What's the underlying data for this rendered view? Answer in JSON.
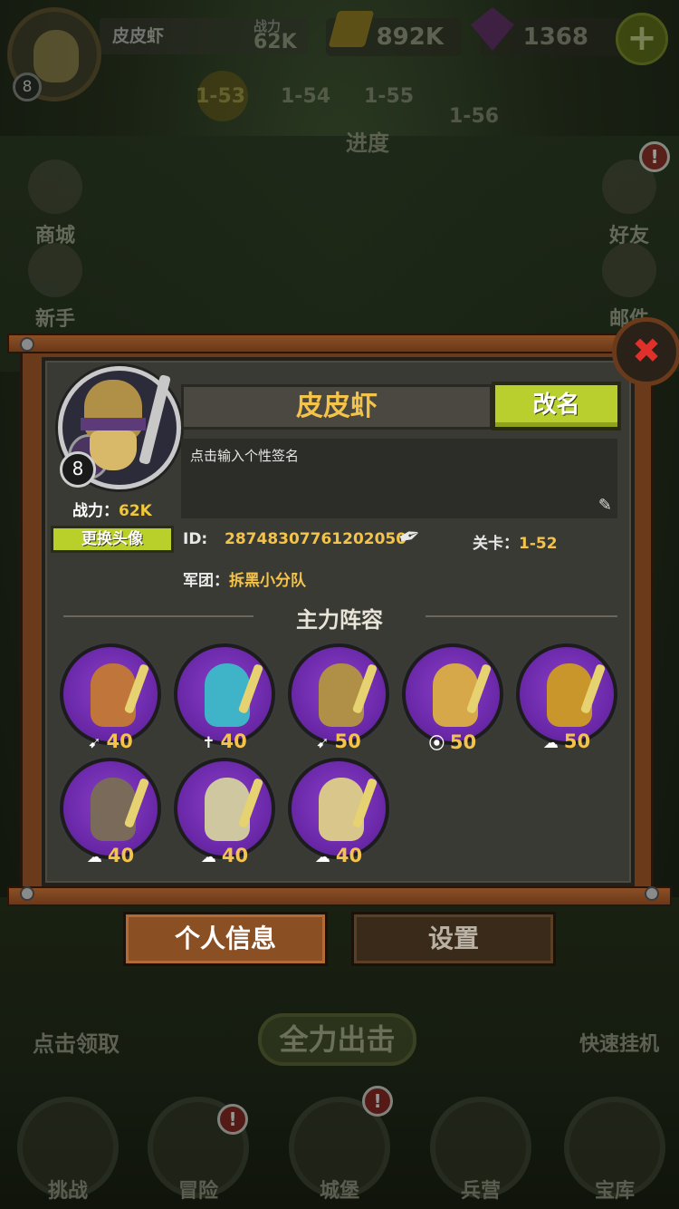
{
  "top_bar": {
    "player_name": "皮皮虾",
    "level": "8",
    "power_label": "战力",
    "power_value": "62K",
    "gold": "892K",
    "gems": "1368",
    "plus": "+"
  },
  "progress": {
    "stages": [
      "1-53",
      "1-54",
      "1-55",
      "1-56"
    ],
    "label": "进度"
  },
  "side_left": [
    {
      "label": "商城"
    },
    {
      "label": "新手"
    }
  ],
  "side_right": [
    {
      "label": "好友",
      "badge": "!"
    },
    {
      "label": "邮件"
    }
  ],
  "background_actions": {
    "chest_label": "点击领取",
    "attack_label": "全力出击",
    "quick_label": "快速挂机"
  },
  "bottom_nav": [
    {
      "label": "挑战"
    },
    {
      "label": "冒险",
      "badge": "!"
    },
    {
      "label": "城堡",
      "badge": "!"
    },
    {
      "label": "兵营"
    },
    {
      "label": "宝库"
    }
  ],
  "dialog": {
    "close": "✖",
    "name": "皮皮虾",
    "rename_button": "改名",
    "portrait_level": "8",
    "power_label": "战力：",
    "power_value": "62K",
    "change_avatar_button": "更换头像",
    "signature_placeholder": "点击输入个性签名",
    "id_label": "ID:",
    "id_value": "28748307761202050",
    "stage_label": "关卡：",
    "stage_value": "1-52",
    "legion_label": "军团：",
    "legion_value": "拆黑小分队",
    "lineup_title": "主力阵容",
    "heroes": [
      {
        "class_icon": "➹",
        "level": "40",
        "color": "#c0763a"
      },
      {
        "class_icon": "✝",
        "level": "40",
        "color": "#3fb3c8"
      },
      {
        "class_icon": "➹",
        "level": "50",
        "color": "#b08f46"
      },
      {
        "class_icon": "⦿",
        "level": "50",
        "color": "#d6a84a"
      },
      {
        "class_icon": "☁",
        "level": "50",
        "color": "#c9962c"
      },
      {
        "class_icon": "☁",
        "level": "40",
        "color": "#7a6a5a"
      },
      {
        "class_icon": "☁",
        "level": "40",
        "color": "#cfc7a0"
      },
      {
        "class_icon": "☁",
        "level": "40",
        "color": "#d9c68a"
      }
    ]
  },
  "tabs": {
    "personal_info": "个人信息",
    "settings": "设置"
  }
}
